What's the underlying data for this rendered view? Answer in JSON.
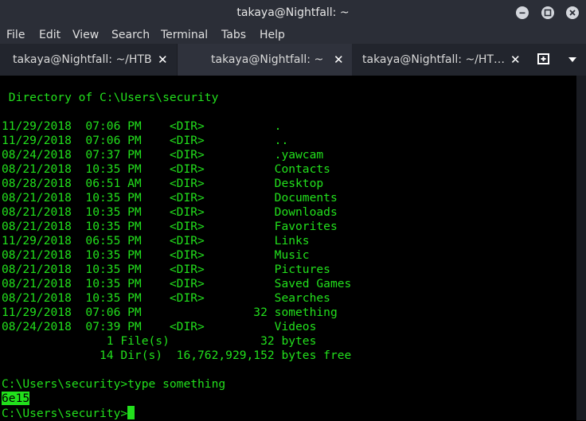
{
  "window": {
    "title": "takaya@Nightfall: ~"
  },
  "menu": [
    "File",
    "Edit",
    "View",
    "Search",
    "Terminal",
    "Tabs",
    "Help"
  ],
  "tabs": [
    {
      "label": "takaya@Nightfall: ~/HTB",
      "close": "✕",
      "active": false
    },
    {
      "label": "takaya@Nightfall: ~",
      "close": "✕",
      "active": true
    },
    {
      "label": "takaya@Nightfall: ~/HT…",
      "close": "✕",
      "active": false
    }
  ],
  "terminal": {
    "header": " Directory of C:\\Users\\security",
    "entries": [
      "11/29/2018  07:06 PM    <DIR>          .",
      "11/29/2018  07:06 PM    <DIR>          ..",
      "08/24/2018  07:37 PM    <DIR>          .yawcam",
      "08/21/2018  10:35 PM    <DIR>          Contacts",
      "08/28/2018  06:51 AM    <DIR>          Desktop",
      "08/21/2018  10:35 PM    <DIR>          Documents",
      "08/21/2018  10:35 PM    <DIR>          Downloads",
      "08/21/2018  10:35 PM    <DIR>          Favorites",
      "11/29/2018  06:55 PM    <DIR>          Links",
      "08/21/2018  10:35 PM    <DIR>          Music",
      "08/21/2018  10:35 PM    <DIR>          Pictures",
      "08/21/2018  10:35 PM    <DIR>          Saved Games",
      "08/21/2018  10:35 PM    <DIR>          Searches",
      "11/29/2018  07:06 PM                32 something",
      "08/24/2018  07:39 PM    <DIR>          Videos"
    ],
    "summary_files": "               1 File(s)             32 bytes",
    "summary_dirs": "              14 Dir(s)  16,762,929,152 bytes free",
    "command": "C:\\Users\\security>type something",
    "output": "6e15",
    "prompt": "C:\\Users\\security>"
  },
  "colors": {
    "terminal_fg": "#22e01c",
    "terminal_bg": "#000000",
    "chrome_bg": "#2b2e37"
  },
  "icons": {
    "minimize": "minimize-icon",
    "maximize": "maximize-icon",
    "close": "close-icon",
    "new_tab": "new-tab-icon",
    "tab_menu": "chevron-down-icon"
  }
}
